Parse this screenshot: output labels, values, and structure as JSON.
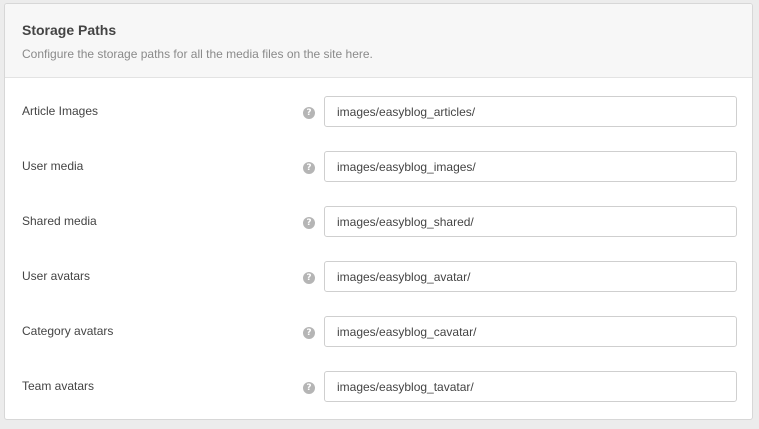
{
  "panel": {
    "title": "Storage Paths",
    "description": "Configure the storage paths for all the media files on the site here."
  },
  "help_icon": {
    "glyph": "?",
    "icon": "question-circle-icon"
  },
  "rows": [
    {
      "label": "Article Images",
      "value": "images/easyblog_articles/"
    },
    {
      "label": "User media",
      "value": "images/easyblog_images/"
    },
    {
      "label": "Shared media",
      "value": "images/easyblog_shared/"
    },
    {
      "label": "User avatars",
      "value": "images/easyblog_avatar/"
    },
    {
      "label": "Category avatars",
      "value": "images/easyblog_cavatar/"
    },
    {
      "label": "Team avatars",
      "value": "images/easyblog_tavatar/"
    }
  ],
  "colors": {
    "background": "#ececec",
    "panel": "#ffffff",
    "header": "#f7f7f7",
    "help_icon": "#b5b5b5",
    "text": "#444444"
  }
}
